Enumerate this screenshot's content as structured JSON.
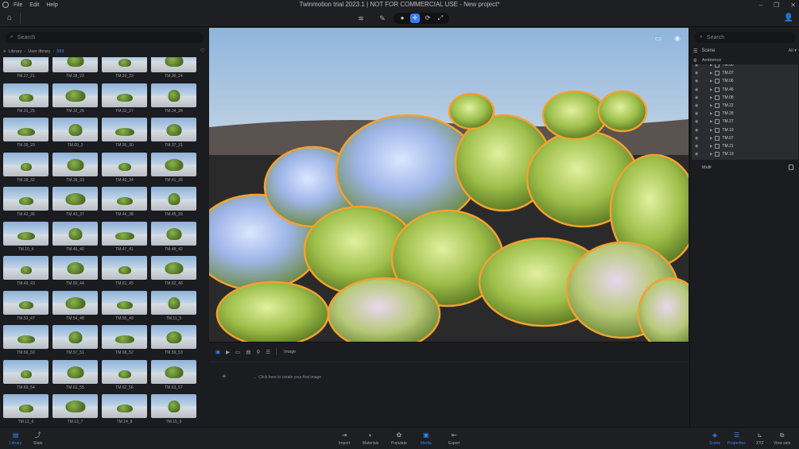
{
  "window": {
    "title": "Twinmotion trial 2023.1 | NOT FOR COMMERCIAL USE - New project*",
    "menu": [
      "File",
      "Edit",
      "Help"
    ]
  },
  "library": {
    "search_placeholder": "Search",
    "breadcrumb": {
      "root": "Library",
      "sub": "User library",
      "count": "583"
    },
    "items": [
      "TM.27_21",
      "TM.28_22",
      "TM.29_23",
      "TM.30_24",
      "TM.31_25",
      "TM.32_26",
      "TM.33_27",
      "TM.34_28",
      "TM.35_29",
      "TM.09_3",
      "TM.36_30",
      "TM.37_31",
      "TM.38_32",
      "TM.39_33",
      "TM.40_34",
      "TM.41_35",
      "TM.42_36",
      "TM.43_37",
      "TM.44_38",
      "TM.45_39",
      "TM.10_4",
      "TM.46_40",
      "TM.47_41",
      "TM.48_42",
      "TM.49_43",
      "TM.50_44",
      "TM.51_45",
      "TM.52_46",
      "TM.53_47",
      "TM.54_48",
      "TM.55_49",
      "TM.11_5",
      "TM.56_50",
      "TM.57_51",
      "TM.58_52",
      "TM.59_53",
      "TM.60_54",
      "TM.61_55",
      "TM.62_56",
      "TM.63_57",
      "TM.12_6",
      "TM.13_7",
      "TM.14_8",
      "TM.15_9"
    ]
  },
  "media": {
    "title": "Image",
    "hint": "Click here to create your first image"
  },
  "scene": {
    "search_placeholder": "Search",
    "title": "Scene",
    "filter": "All",
    "ambience": "Ambience",
    "items": [
      "TM.60",
      "TM.07",
      "TM.06",
      "TM.46",
      "TM.08",
      "TM.22",
      "TM.28",
      "TM.27",
      "TM.19",
      "TM.07",
      "TM.21",
      "TM.19"
    ],
    "multi": "Multi"
  },
  "bottom": {
    "left": [
      {
        "label": "Library",
        "icon": "library-icon",
        "active": true
      },
      {
        "label": "Stats",
        "icon": "stats-icon",
        "active": false
      }
    ],
    "center": [
      {
        "label": "Import",
        "icon": "import-icon",
        "active": false
      },
      {
        "label": "Materials",
        "icon": "materials-icon",
        "active": false
      },
      {
        "label": "Populate",
        "icon": "populate-icon",
        "active": false
      },
      {
        "label": "Media",
        "icon": "media-icon",
        "active": true
      },
      {
        "label": "Export",
        "icon": "export-icon",
        "active": false
      }
    ],
    "right": [
      {
        "label": "Scene",
        "icon": "scene-icon",
        "active": true
      },
      {
        "label": "Properties",
        "icon": "properties-icon",
        "active": true
      },
      {
        "label": "XYZ",
        "icon": "xyz-icon",
        "active": false
      },
      {
        "label": "View sets",
        "icon": "view-sets-icon",
        "active": false
      }
    ]
  },
  "colors": {
    "accent": "#2f86ff",
    "selection_outline": "#f2a230"
  }
}
